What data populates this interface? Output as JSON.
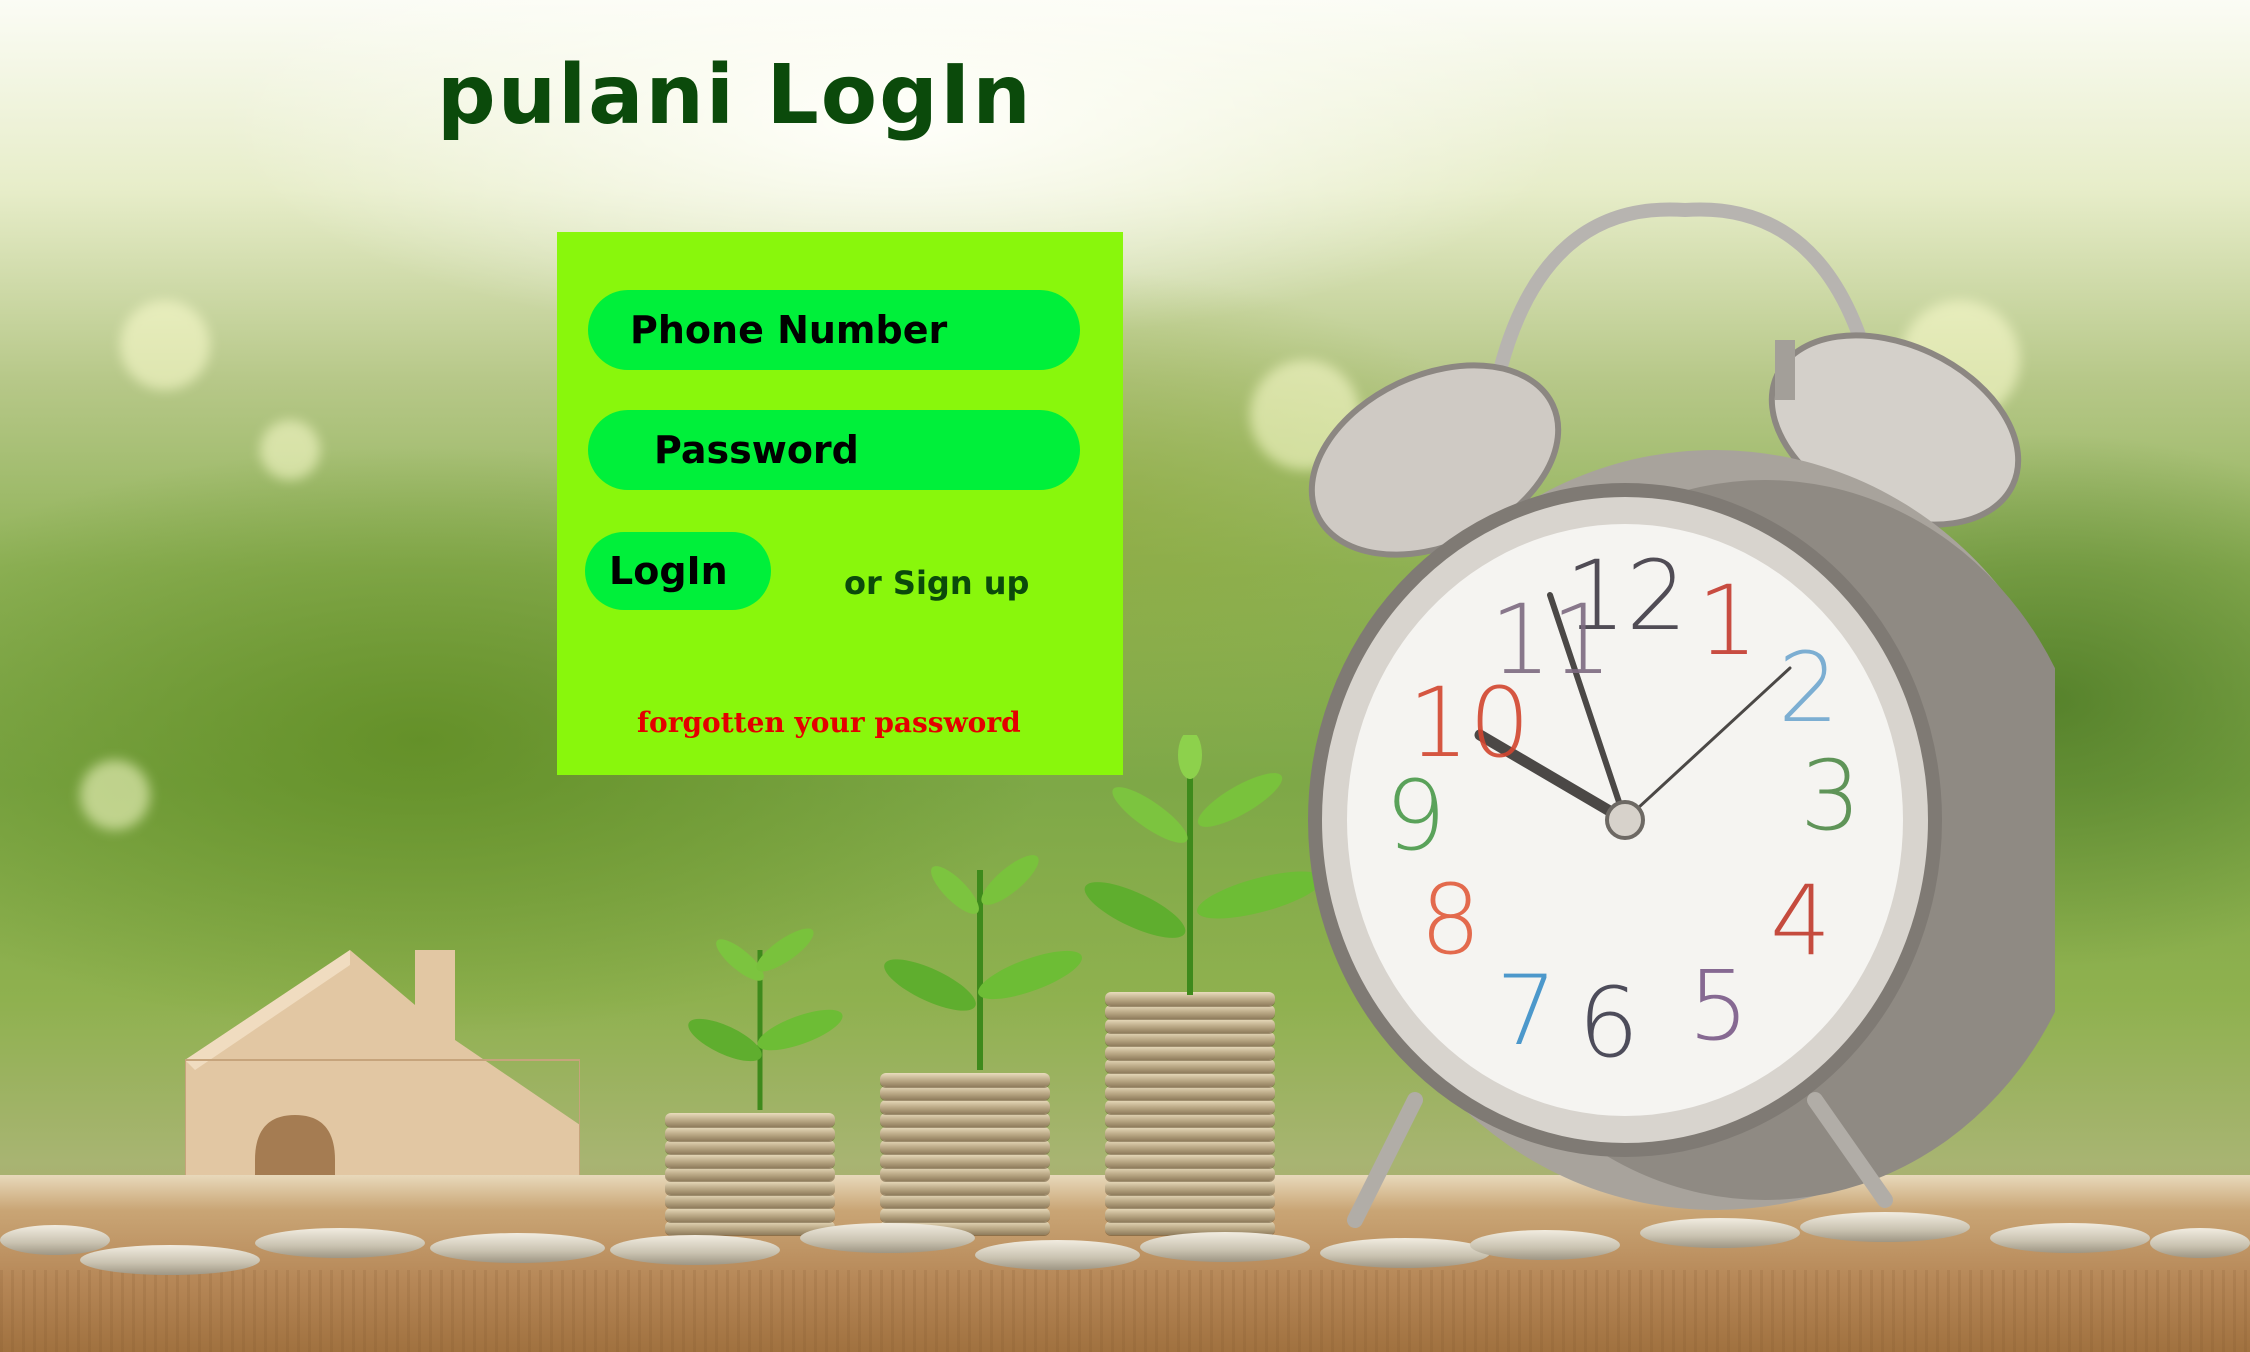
{
  "page": {
    "title": "pulani LogIn"
  },
  "login_form": {
    "phone_placeholder": "Phone Number",
    "password_placeholder": "Password",
    "login_button": "LogIn",
    "signup_link": "or Sign up",
    "forgot_link": "forgotten your password"
  },
  "clock_face": {
    "numbers": [
      "12",
      "1",
      "2",
      "3",
      "4",
      "5",
      "6",
      "7",
      "8",
      "9",
      "10",
      "11"
    ]
  },
  "colors": {
    "title": "#0b4a0b",
    "panel_bg": "#89f70c",
    "field_bg": "#00f03a",
    "signup": "#0b4a0b",
    "forgot": "#e40000"
  }
}
